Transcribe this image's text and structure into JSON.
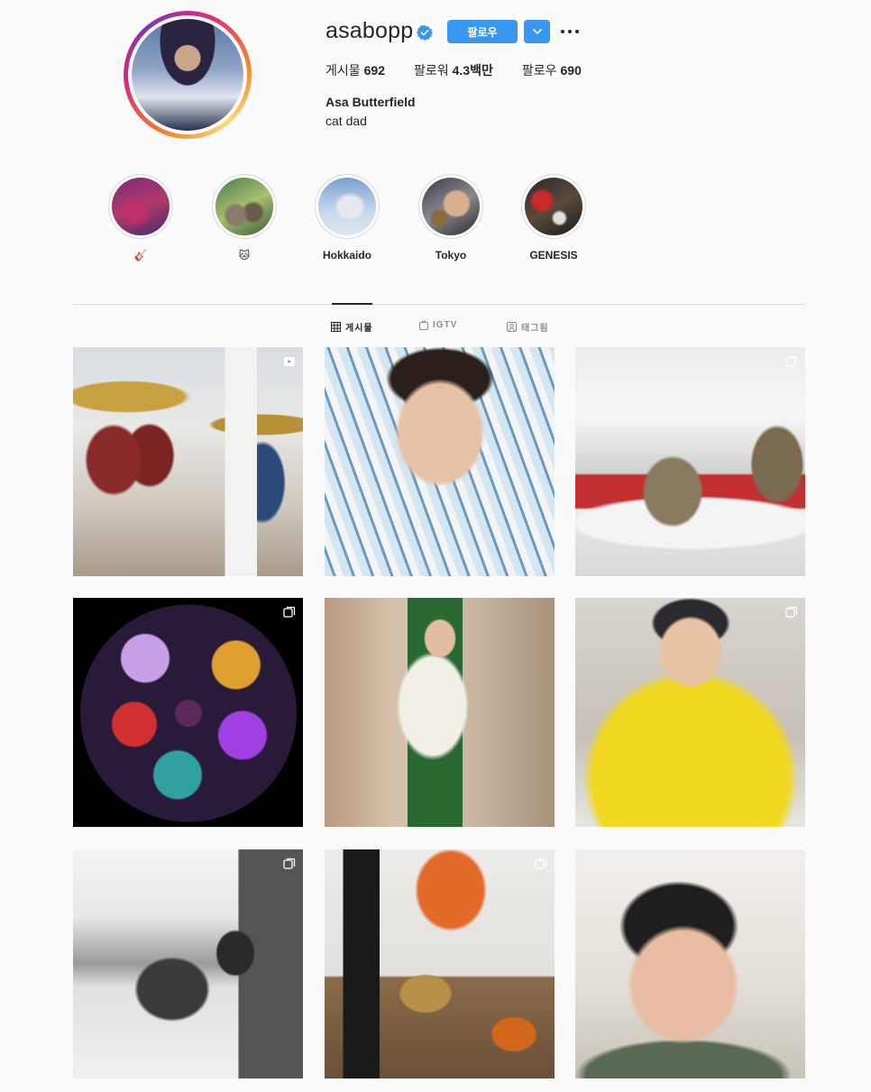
{
  "profile": {
    "username": "asabopp",
    "follow_label": "팔로우",
    "stats": [
      {
        "label": "게시물",
        "value": "692"
      },
      {
        "label": "팔로워",
        "value": "4.3백만"
      },
      {
        "label": "팔로우",
        "value": "690"
      }
    ],
    "full_name": "Asa Butterfield",
    "bio": "cat dad"
  },
  "highlights": [
    {
      "label": "🎸"
    },
    {
      "label": "🐱"
    },
    {
      "label": "Hokkaido"
    },
    {
      "label": "Tokyo"
    },
    {
      "label": "GENESIS"
    }
  ],
  "tabs": [
    {
      "label": "게시물",
      "icon": "grid-icon",
      "active": true
    },
    {
      "label": "IGTV",
      "icon": "igtv-icon",
      "active": false
    },
    {
      "label": "태그됨",
      "icon": "tagged-icon",
      "active": false
    }
  ],
  "colors": {
    "accent": "#3897f0",
    "text": "#262626",
    "muted": "#8e8e8e",
    "background": "#fafafa"
  },
  "posts": [
    {
      "subject": "drum kit",
      "badge": "video-icon"
    },
    {
      "subject": "selfie striped shirt",
      "badge": ""
    },
    {
      "subject": "cats in hammock",
      "badge": "carousel-icon"
    },
    {
      "subject": "butterfly mandala art",
      "badge": "carousel-icon"
    },
    {
      "subject": "mirror selfie overalls",
      "badge": ""
    },
    {
      "subject": "yellow hoodie selfie",
      "badge": "carousel-icon"
    },
    {
      "subject": "cat in snow",
      "badge": "carousel-icon"
    },
    {
      "subject": "music room",
      "badge": "carousel-icon"
    },
    {
      "subject": "beanie selfie",
      "badge": ""
    }
  ]
}
